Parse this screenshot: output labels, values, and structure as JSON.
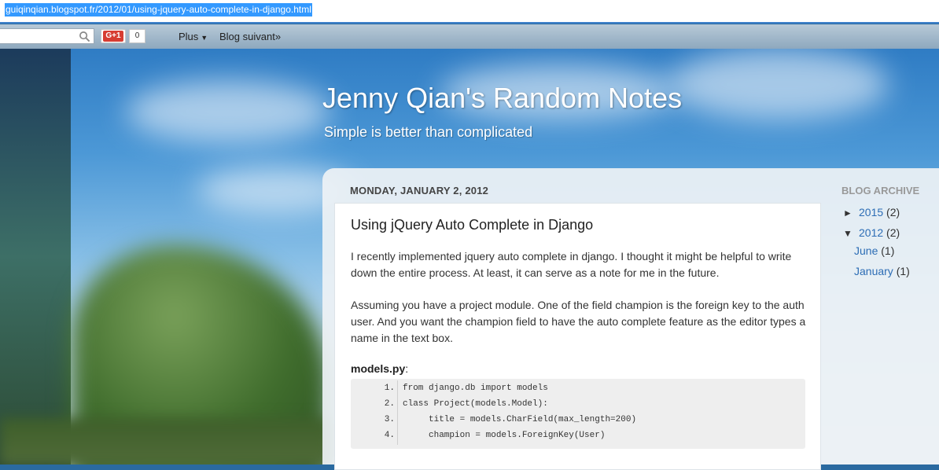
{
  "browser": {
    "url": "guiqinqian.blogspot.fr/2012/01/using-jquery-auto-complete-in-django.html"
  },
  "navbar": {
    "search_icon": "search-icon",
    "gplus_label": "G+1",
    "gplus_count": "0",
    "more_label": "Plus",
    "more_icon": "caret-down-icon",
    "next_blog_label": "Blog suivant»"
  },
  "header": {
    "title": "Jenny Qian's Random Notes",
    "description": "Simple is better than complicated"
  },
  "post": {
    "date": "MONDAY, JANUARY 2, 2012",
    "title": "Using jQuery Auto Complete in Django",
    "paragraph1": "I recently implemented jquery auto complete in django. I thought it might be helpful to write down the entire process. At least, it can serve as a note for me in the future.",
    "paragraph2": "Assuming you have a project module. One of the field champion is the foreign key to the auth user. And you want the champion field to have the auto complete feature as the editor types a name in the text box.",
    "code_file": "models.py",
    "code_file_suffix": ":",
    "code_lines": [
      {
        "num": "1.",
        "text": "from django.db import models"
      },
      {
        "num": "2.",
        "text": "class Project(models.Model):"
      },
      {
        "num": "3.",
        "text": "     title = models.CharField(max_length=200)"
      },
      {
        "num": "4.",
        "text": "     champion = models.ForeignKey(User)"
      }
    ]
  },
  "sidebar": {
    "heading": "BLOG ARCHIVE",
    "items": [
      {
        "toggle": "►",
        "label": "2015",
        "count": "(2)"
      },
      {
        "toggle": "▼",
        "label": "2012",
        "count": "(2)"
      },
      {
        "label": "June",
        "count": "(1)"
      },
      {
        "label": "January",
        "count": "(1)"
      }
    ]
  },
  "colors": {
    "link": "#2d6db5",
    "url_highlight": "#3399ff",
    "gplus": "#d73d32"
  }
}
